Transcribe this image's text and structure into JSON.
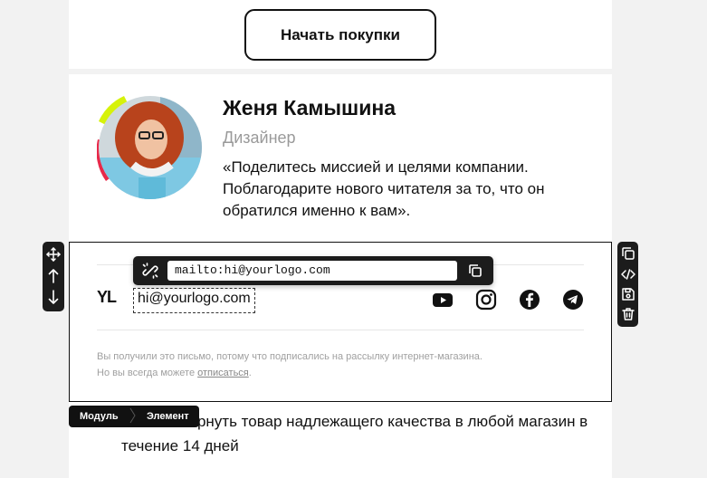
{
  "cta": {
    "label": "Начать покупки"
  },
  "profile": {
    "name": "Женя Камышина",
    "role": "Дизайнер",
    "quote": "«Поделитесь миссией и целями компании. Поблагодарите нового читателя за то, что он обратился именно к вам».",
    "accent_colors": [
      "#d6f20a",
      "#e8294a"
    ]
  },
  "footer": {
    "logo": "YL",
    "email": "hi@yourlogo.com",
    "social_icons": [
      "youtube-icon",
      "instagram-icon",
      "facebook-icon",
      "telegram-icon"
    ],
    "legal_line1": "Вы получили это письмо, потому что подписались на рассылку интернет-магазина.",
    "legal_line2_prefix": "Но вы всегда можете ",
    "unsubscribe_link": "отписаться",
    "legal_line2_suffix": "."
  },
  "link_editor": {
    "url": "mailto:hi@yourlogo.com",
    "unlink_icon": "unlink-icon",
    "copy_icon": "copy-icon"
  },
  "left_toolbar": {
    "icons": [
      "move-icon",
      "arrow-up-icon",
      "arrow-down-icon"
    ]
  },
  "right_toolbar": {
    "icons": [
      "duplicate-icon",
      "code-icon",
      "save-icon",
      "trash-icon"
    ]
  },
  "breadcrumbs": {
    "module": "Модуль",
    "element": "Элемент"
  },
  "bullet_text": "Можете вернуть товар надлежащего качества в любой магазин в течение 14 дней"
}
